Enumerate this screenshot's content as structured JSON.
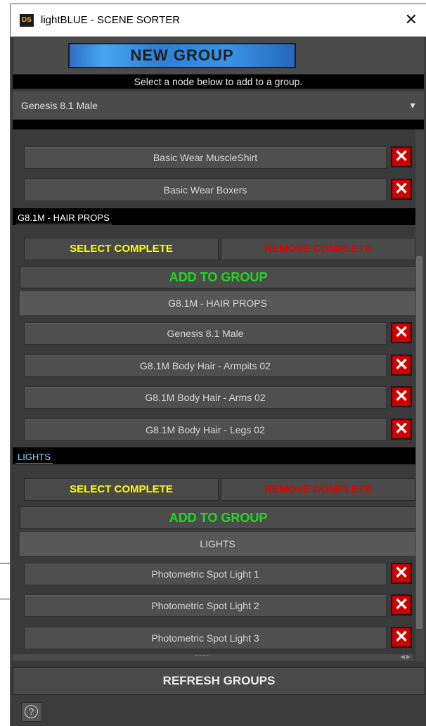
{
  "window": {
    "logo_text": "DS",
    "title": "lightBLUE - SCENE SORTER",
    "close_glyph": "✕"
  },
  "new_group_label": "NEW GROUP",
  "hint": "Select a node below to add to a group.",
  "node_select": {
    "value": "Genesis 8.1 Male",
    "arrow_glyph": "▼"
  },
  "delete_glyph": "✕",
  "ungrouped_items": [
    {
      "label": "Basic Wear MuscleShirt"
    },
    {
      "label": "Basic Wear Boxers"
    }
  ],
  "groups": [
    {
      "header": "G8.1M - HAIR PROPS",
      "header_color": "#ffffff",
      "select_complete": "SELECT COMPLETE",
      "remove_complete": "REMOVE COMPLETE",
      "add_to_group": "ADD TO GROUP",
      "name": "G8.1M - HAIR PROPS",
      "items": [
        {
          "label": "Genesis 8.1 Male"
        },
        {
          "label": "G8.1M Body Hair - Armpits 02"
        },
        {
          "label": "G8.1M Body Hair - Arms 02"
        },
        {
          "label": "G8.1M Body Hair - Legs 02"
        }
      ]
    },
    {
      "header": "LIGHTS",
      "header_color": "#7fe0ff",
      "select_complete": "SELECT COMPLETE",
      "remove_complete": "REMOVE COMPLETE",
      "add_to_group": "ADD TO GROUP",
      "name": "LIGHTS",
      "items": [
        {
          "label": "Photometric Spot Light 1"
        },
        {
          "label": "Photometric Spot Light 2"
        },
        {
          "label": "Photometric Spot Light 3"
        }
      ]
    }
  ],
  "refresh_label": "REFRESH GROUPS",
  "help_glyph": "?",
  "colors": {
    "accent_blue": "#3a93e6",
    "select_yellow": "#ffff00",
    "remove_red": "#e00000",
    "add_green": "#1fd81f",
    "delete_red": "#cc0000"
  }
}
